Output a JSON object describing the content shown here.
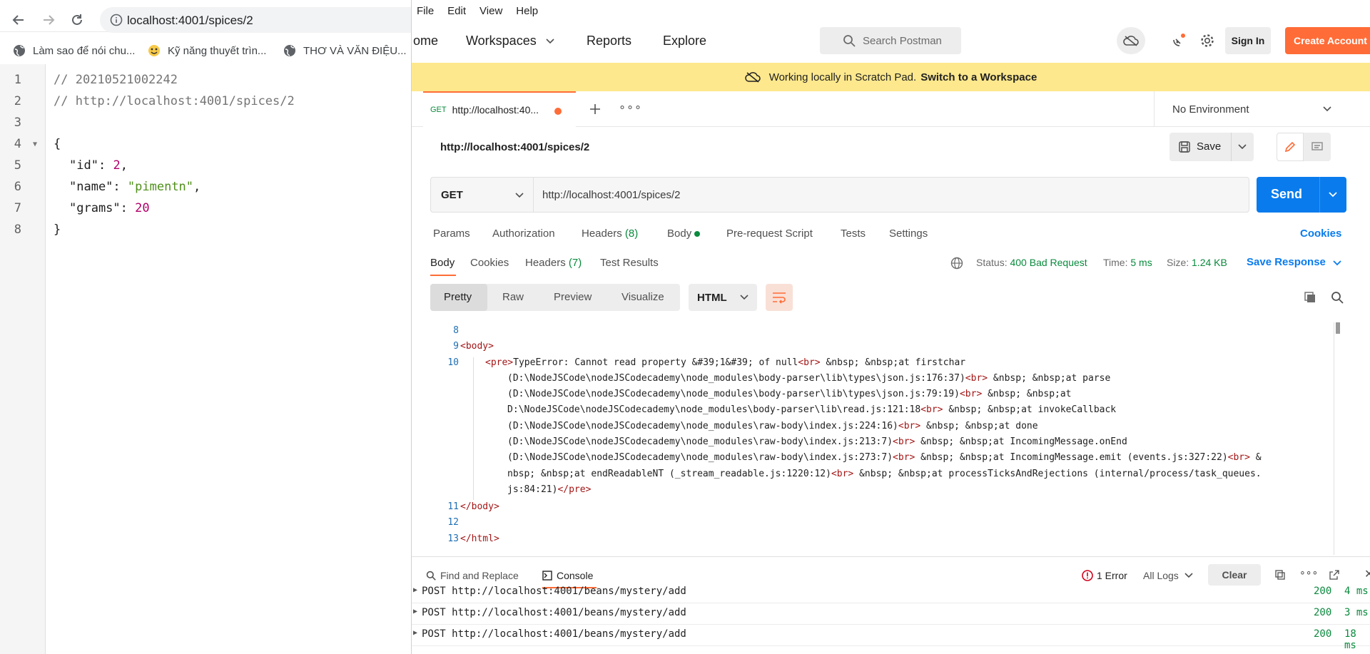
{
  "browser": {
    "url": "localhost:4001/spices/2",
    "bookmarks": [
      {
        "label": "Làm sao để nói chu...",
        "icon": "globe-icon"
      },
      {
        "label": "Kỹ năng thuyết trìn...",
        "icon": "emoji-favicon"
      },
      {
        "label": "THƠ VÀ VĂN ĐIỆU...",
        "icon": "globe-icon"
      }
    ],
    "code_lines": {
      "l1": "// 20210521002242",
      "l2": "// http://localhost:4001/spices/2",
      "l4": "{",
      "k_id": "\"id\"",
      "v_id": "2",
      "k_name": "\"name\"",
      "v_name": "\"pimentn\"",
      "k_grams": "\"grams\"",
      "v_grams": "20",
      "l8": "}"
    },
    "line_numbers": [
      "1",
      "2",
      "3",
      "4",
      "5",
      "6",
      "7",
      "8"
    ]
  },
  "postman": {
    "menu": [
      "File",
      "Edit",
      "View",
      "Help"
    ],
    "nav": {
      "home": "ome",
      "workspaces": "Workspaces",
      "reports": "Reports",
      "explore": "Explore"
    },
    "search_placeholder": "Search Postman",
    "sign_in": "Sign In",
    "create_account": "Create Account",
    "banner": {
      "text": "Working locally in Scratch Pad.",
      "link": "Switch to a Workspace"
    },
    "tab": {
      "method": "GET",
      "title": "http://localhost:40..."
    },
    "environment": "No Environment",
    "request_name": "http://localhost:4001/spices/2",
    "save_label": "Save",
    "method": "GET",
    "url": "http://localhost:4001/spices/2",
    "send_label": "Send",
    "req_tabs": {
      "params": "Params",
      "authorization": "Authorization",
      "headers": "Headers",
      "headers_count": "(8)",
      "body": "Body",
      "prerequest": "Pre-request Script",
      "tests": "Tests",
      "settings": "Settings",
      "cookies": "Cookies"
    },
    "resp_tabs": {
      "body": "Body",
      "cookies": "Cookies",
      "headers": "Headers",
      "headers_count": "(7)",
      "test_results": "Test Results"
    },
    "status": {
      "status_label": "Status:",
      "status_value": "400 Bad Request",
      "time_label": "Time:",
      "time_value": "5 ms",
      "size_label": "Size:",
      "size_value": "1.24 KB",
      "save_response": "Save Response"
    },
    "view_modes": {
      "pretty": "Pretty",
      "raw": "Raw",
      "preview": "Preview",
      "visualize": "Visualize"
    },
    "format": "HTML",
    "response": {
      "ln8": "8",
      "ln9": "9",
      "ln10": "10",
      "ln11": "11",
      "ln12": "12",
      "ln13": "13",
      "body_open": "<body>",
      "pre_open": "<pre>",
      "err1": "TypeError: Cannot read property &#39;1&#39; of null",
      "br": "<br>",
      "err1b": " &nbsp; &nbsp;at firstchar",
      "w1": "(D:\\NodeJSCode\\nodeJSCodecademy\\node_modules\\body-parser\\lib\\types\\json.js:176:37)",
      "w1b": " &nbsp; &nbsp;at parse",
      "w2": "(D:\\NodeJSCode\\nodeJSCodecademy\\node_modules\\body-parser\\lib\\types\\json.js:79:19)",
      "w2b": " &nbsp; &nbsp;at",
      "w3": "D:\\NodeJSCode\\nodeJSCodecademy\\node_modules\\body-parser\\lib\\read.js:121:18",
      "w3b": " &nbsp; &nbsp;at invokeCallback",
      "w4": "(D:\\NodeJSCode\\nodeJSCodecademy\\node_modules\\raw-body\\index.js:224:16)",
      "w4b": " &nbsp; &nbsp;at done",
      "w5": "(D:\\NodeJSCode\\nodeJSCodecademy\\node_modules\\raw-body\\index.js:213:7)",
      "w5b": " &nbsp; &nbsp;at IncomingMessage.onEnd",
      "w6": "(D:\\NodeJSCode\\nodeJSCodecademy\\node_modules\\raw-body\\index.js:273:7)",
      "w6b": " &nbsp; &nbsp;at IncomingMessage.emit (events.js:327:22)",
      "w6c": " &",
      "w7a": "nbsp; &nbsp;at endReadableNT (_stream_readable.js:1220:12)",
      "w7b": " &nbsp; &nbsp;at processTicksAndRejections (internal/process/task_queues.",
      "w8a": "js:84:21)",
      "pre_close": "</pre>",
      "body_close": "</body>",
      "html_close": "</html>"
    },
    "bottom": {
      "find_replace": "Find and Replace",
      "console": "Console",
      "errors": "1 Error",
      "all_logs": "All Logs",
      "clear": "Clear"
    },
    "console_rows": [
      {
        "text": "POST http://localhost:4001/beans/mystery/add",
        "code": "200",
        "time": "4 ms"
      },
      {
        "text": "POST http://localhost:4001/beans/mystery/add",
        "code": "200",
        "time": "3 ms"
      },
      {
        "text": "POST http://localhost:4001/beans/mystery/add",
        "code": "200",
        "time": "18 ms"
      }
    ],
    "colors": {
      "accent": "#ff6c37",
      "send": "#097bed",
      "success": "#0a8a3d",
      "banner": "#fde88d"
    }
  }
}
